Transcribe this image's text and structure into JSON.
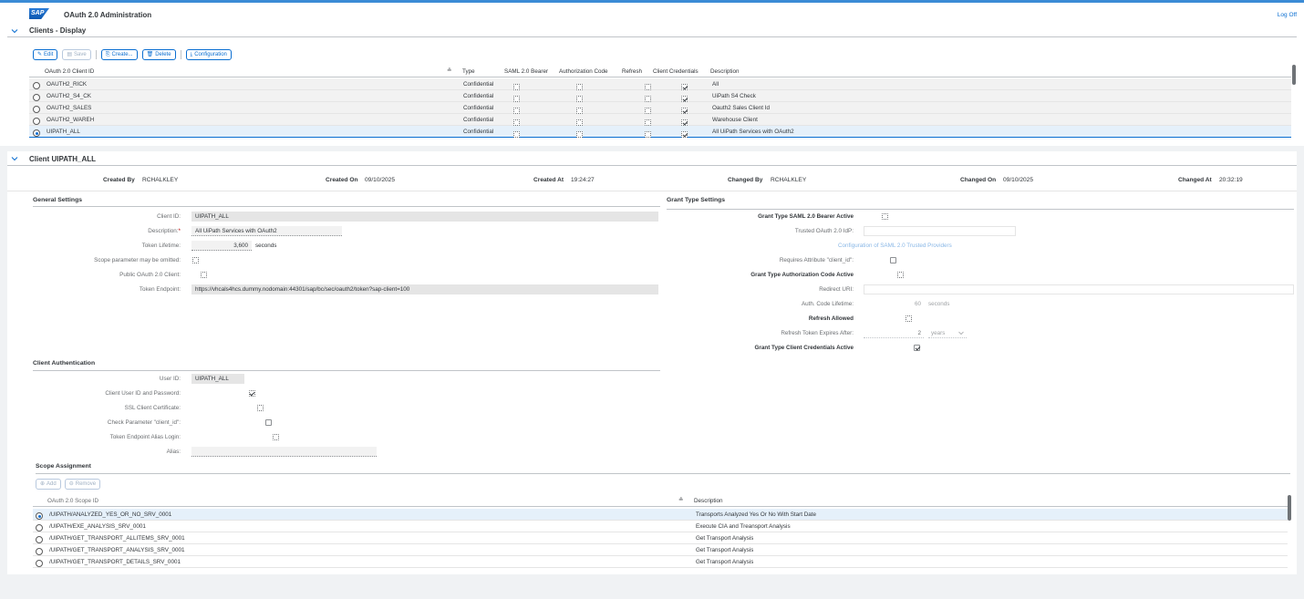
{
  "app": {
    "title": "OAuth 2.0 Administration",
    "logo_text": "SAP",
    "logoff": "Log Off"
  },
  "clients_section": {
    "title": "Clients - Display",
    "toolbar": {
      "edit": "Edit",
      "save": "Save",
      "create": "Create...",
      "delete": "Delete",
      "configuration": "Configuration"
    },
    "columns": {
      "client_id": "OAuth 2.0 Client ID",
      "type": "Type",
      "saml": "SAML 2.0 Bearer",
      "auth_code": "Authorization Code",
      "refresh": "Refresh",
      "client_credentials": "Client Credentials",
      "description": "Description"
    },
    "rows": [
      {
        "id": "OAUTH2_RICK",
        "type": "Confidential",
        "saml": false,
        "auth": false,
        "refresh": false,
        "cc": true,
        "desc": "All",
        "selected": false
      },
      {
        "id": "OAUTH2_S4_CK",
        "type": "Confidential",
        "saml": false,
        "auth": false,
        "refresh": false,
        "cc": true,
        "desc": "UiPath S4 Check",
        "selected": false
      },
      {
        "id": "OAUTH2_SALES",
        "type": "Confidential",
        "saml": false,
        "auth": false,
        "refresh": false,
        "cc": true,
        "desc": "Oauth2 Sales Client Id",
        "selected": false
      },
      {
        "id": "OAUTH2_WAREH",
        "type": "Confidential",
        "saml": false,
        "auth": false,
        "refresh": false,
        "cc": true,
        "desc": "Warehouse Client",
        "selected": false
      },
      {
        "id": "UIPATH_ALL",
        "type": "Confidential",
        "saml": false,
        "auth": false,
        "refresh": false,
        "cc": true,
        "desc": "All UiPath Services with OAuth2",
        "selected": true
      }
    ]
  },
  "client_section": {
    "title": "Client UIPATH_ALL",
    "meta": {
      "created_by_label": "Created By",
      "created_by": "RCHALKLEY",
      "created_on_label": "Created On",
      "created_on": "09/10/2025",
      "created_at_label": "Created At",
      "created_at": "19:24:27",
      "changed_by_label": "Changed By",
      "changed_by": "RCHALKLEY",
      "changed_on_label": "Changed On",
      "changed_on": "09/10/2025",
      "changed_at_label": "Changed At",
      "changed_at": "20:32:19"
    },
    "general": {
      "title": "General Settings",
      "client_id_label": "Client ID:",
      "client_id": "UIPATH_ALL",
      "description_label": "Description:",
      "required_mark": "*",
      "description": "All UiPath Services with OAuth2",
      "token_lifetime_label": "Token Lifetime:",
      "token_lifetime": "3,600",
      "token_lifetime_unit": "seconds",
      "scope_omit_label": "Scope parameter may be omitted:",
      "public_client_label": "Public OAuth 2.0 Client:",
      "token_endpoint_label": "Token Endpoint:",
      "token_endpoint": "https://vhcals4hcs.dummy.nodomain:44301/sap/bc/sec/oauth2/token?sap-client=100"
    },
    "grant": {
      "title": "Grant Type Settings",
      "saml_active_label": "Grant Type SAML 2.0 Bearer Active",
      "trusted_idp_label": "Trusted OAuth 2.0 IdP:",
      "config_link": "Configuration of SAML 2.0 Trusted Providers",
      "requires_attr_label": "Requires Attribute \"client_id\":",
      "auth_code_active_label": "Grant Type Authorization Code Active",
      "redirect_uri_label": "Redirect URI:",
      "auth_code_lifetime_label": "Auth. Code Lifetime:",
      "auth_code_lifetime": "60",
      "auth_code_lifetime_unit": "seconds",
      "refresh_allowed_label": "Refresh Allowed",
      "refresh_expires_label": "Refresh Token Expires After:",
      "refresh_expires": "2",
      "refresh_expires_unit": "years",
      "cc_active_label": "Grant Type Client Credentials Active"
    },
    "auth": {
      "title": "Client Authentication",
      "user_id_label": "User ID:",
      "user_id": "UIPATH_ALL",
      "user_pw_label": "Client User ID and Password:",
      "ssl_label": "SSL Client Certificate:",
      "check_param_label": "Check Parameter \"client_id\":",
      "alias_login_label": "Token Endpoint Alias Login:",
      "alias_label": "Alias:"
    },
    "scope": {
      "title": "Scope Assignment",
      "add": "Add",
      "remove": "Remove",
      "col_id": "OAuth 2.0 Scope ID",
      "col_desc": "Description",
      "rows": [
        {
          "id": "/UIPATH/ANALYZED_YES_OR_NO_SRV_0001",
          "desc": "Transports Analyzed Yes Or No With Start Date",
          "selected": true
        },
        {
          "id": "/UIPATH/EXE_ANALYSIS_SRV_0001",
          "desc": "Execute CIA and Treansport Analysis",
          "selected": false
        },
        {
          "id": "/UIPATH/GET_TRANSPORT_ALLITEMS_SRV_0001",
          "desc": "Get Transport Analysis",
          "selected": false
        },
        {
          "id": "/UIPATH/GET_TRANSPORT_ANALYSIS_SRV_0001",
          "desc": "Get Transport Analysis",
          "selected": false
        },
        {
          "id": "/UIPATH/GET_TRANSPORT_DETAILS_SRV_0001",
          "desc": "Get Transport Analysis",
          "selected": false
        }
      ]
    }
  }
}
